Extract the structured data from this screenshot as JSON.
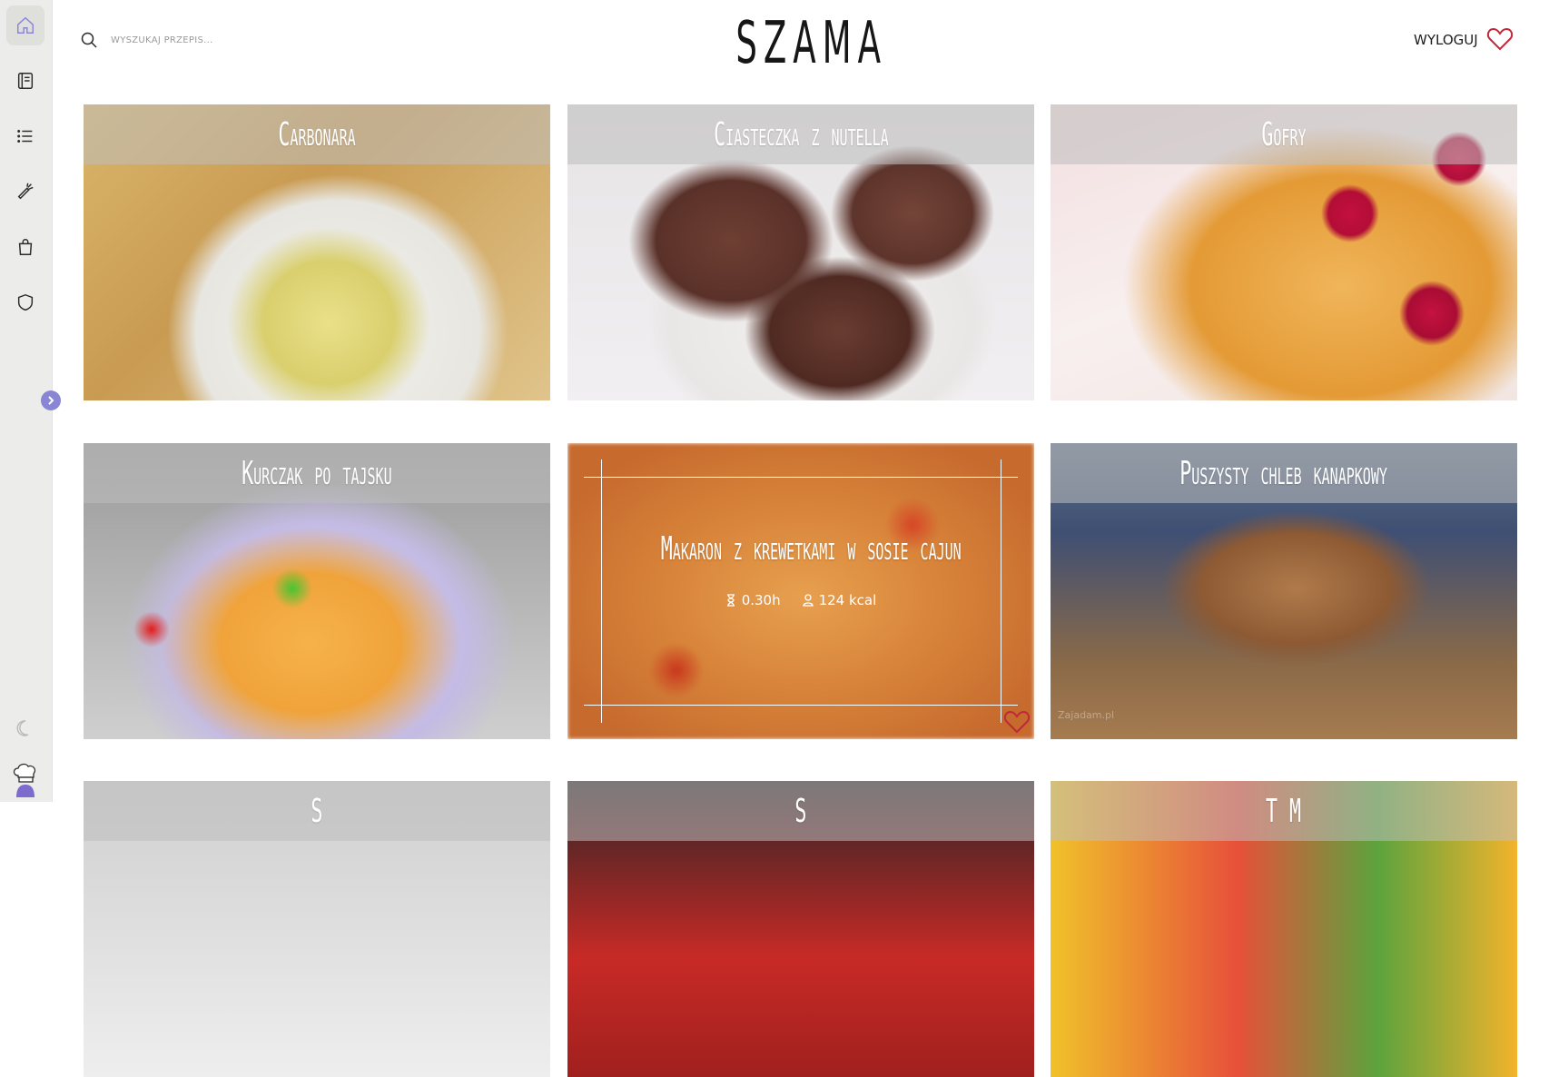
{
  "app": {
    "logo": "SZAMA"
  },
  "sidebar": {
    "items": [
      {
        "icon": "home-icon",
        "label": "Home"
      },
      {
        "icon": "recipe-book-icon",
        "label": "Przepisy"
      },
      {
        "icon": "list-icon",
        "label": "Lista"
      },
      {
        "icon": "carrot-icon",
        "label": "Składniki"
      },
      {
        "icon": "shopping-bag-icon",
        "label": "Zakupy"
      },
      {
        "icon": "shield-icon",
        "label": "Admin"
      }
    ]
  },
  "search": {
    "placeholder": "WYSZUKAJ PRZEPIS..."
  },
  "header": {
    "logout_label": "WYLOGUJ"
  },
  "recipes": [
    {
      "title": "Carbonara"
    },
    {
      "title": "Ciasteczka z nutella"
    },
    {
      "title": "Gofry"
    },
    {
      "title": "Kurczak po tajsku"
    },
    {
      "title": "Makaron z krewetkami w sosie cajun",
      "time": "0.30h",
      "kcal": "124 kcal",
      "favorite": true
    },
    {
      "title": "Puszysty chleb kanapkowy",
      "watermark": "Zajadam.pl"
    },
    {
      "title": "S"
    },
    {
      "title": "S"
    },
    {
      "title": "T M"
    }
  ],
  "colors": {
    "accent": "#8a86d6",
    "heart": "#c0283a"
  }
}
